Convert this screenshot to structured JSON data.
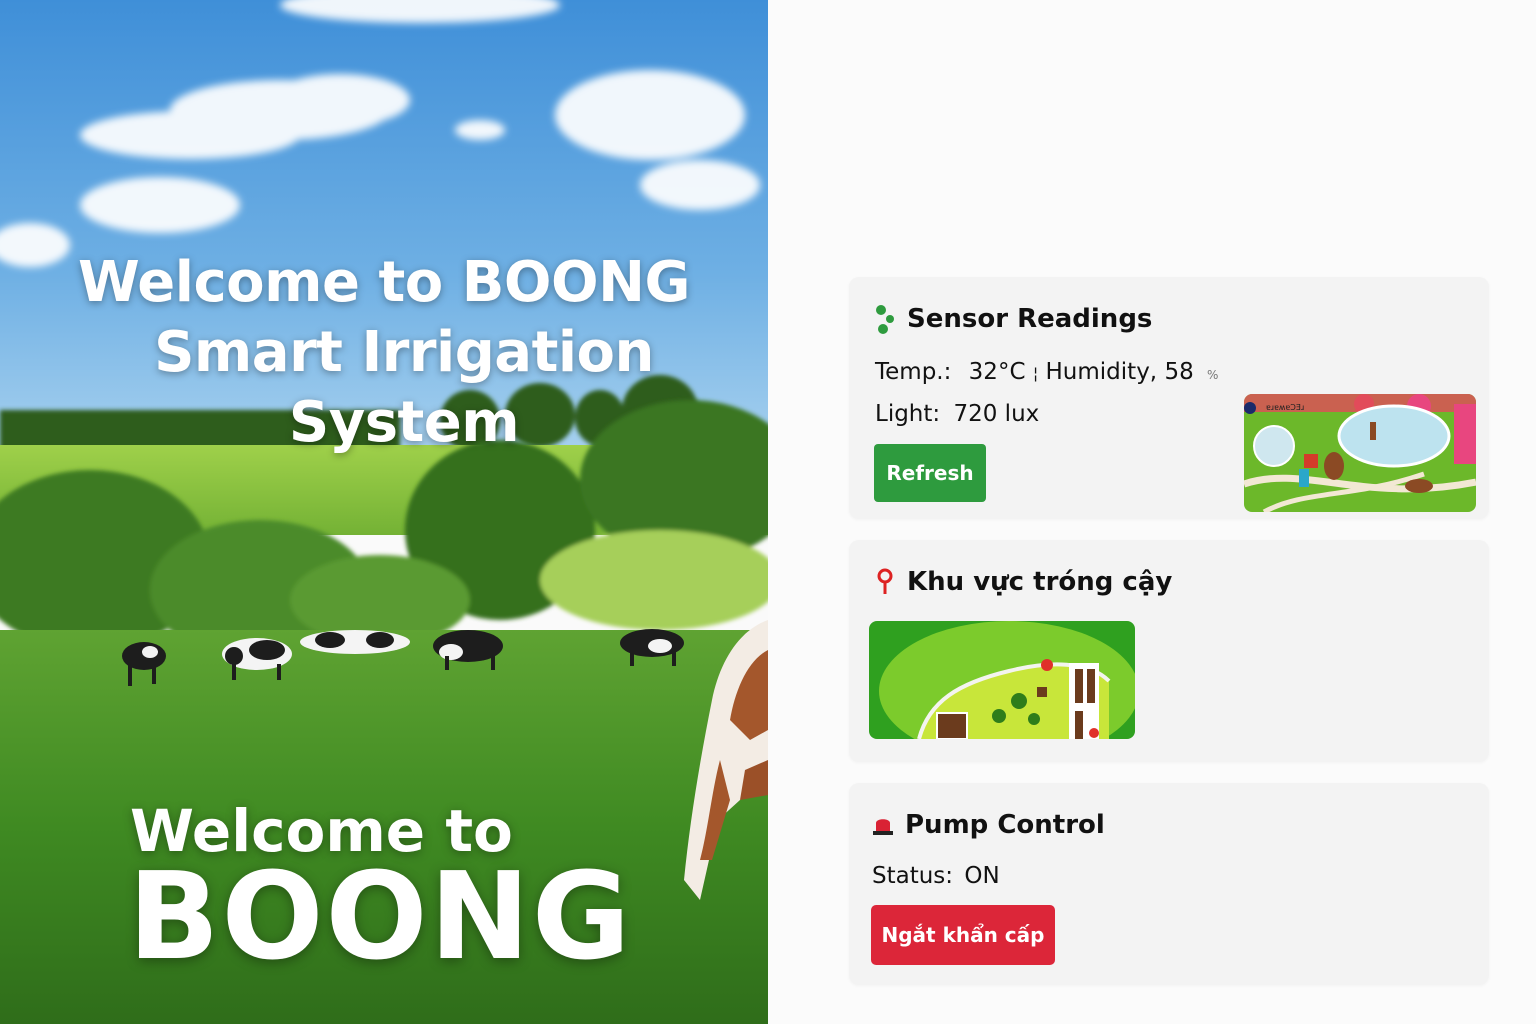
{
  "hero": {
    "title_line1": "Welcome to BOONG",
    "title_line2": "Smart Irrigation System",
    "welcome": "Welcome to",
    "brand": "BOONG"
  },
  "sensor": {
    "title": "Sensor Readings",
    "icon": "seedling-icon",
    "temp_label": "Temp.:",
    "temp_value": "32°C",
    "separator": "¦",
    "humidity_label": "Humidity,",
    "humidity_value": "58",
    "humidity_unit": "%",
    "light_label": "Light:",
    "light_value": "720 lux",
    "refresh_label": "Refresh",
    "map_caption": "ɐɹɐʍɐƆƎɹ"
  },
  "zone": {
    "title": "Khu vực tróng cậy",
    "icon": "location-pin-icon"
  },
  "pump": {
    "title": "Pump Control",
    "icon": "alarm-light-icon",
    "status_label": "Status:",
    "status_value": "ON",
    "stop_label": "Ngắt khẩn cấp"
  },
  "colors": {
    "accent_green": "#2e9b3e",
    "danger_red": "#dc2639",
    "card_bg": "#f3f3f3"
  }
}
